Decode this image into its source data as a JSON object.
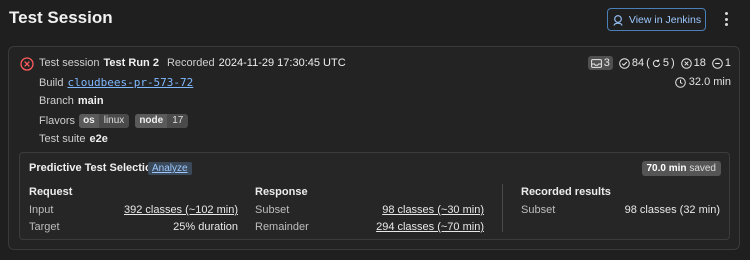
{
  "header": {
    "title": "Test Session",
    "jenkins_button": "View in Jenkins"
  },
  "session": {
    "status": "failed",
    "label_session": "Test session",
    "name": "Test Run 2",
    "label_recorded": "Recorded",
    "recorded": "2024-11-29 17:30:45 UTC",
    "label_build": "Build",
    "build": "cloudbees-pr-573-72",
    "label_branch": "Branch",
    "branch": "main",
    "label_flavors": "Flavors",
    "flavors": [
      {
        "key": "os",
        "value": "linux"
      },
      {
        "key": "node",
        "value": "17"
      }
    ],
    "label_suite": "Test suite",
    "suite": "e2e",
    "stats": {
      "tray": "3",
      "passed": "84",
      "retried": "5",
      "failed": "18",
      "skipped": "1"
    },
    "duration": "32.0 min"
  },
  "pts": {
    "title": "Predictive Test Selection",
    "analyze": "Analyze",
    "saved_value": "70.0 min",
    "saved_label": "saved",
    "request": {
      "heading": "Request",
      "input_label": "Input",
      "input_value": "392 classes (~102 min)",
      "target_label": "Target",
      "target_value": "25% duration"
    },
    "response": {
      "heading": "Response",
      "subset_label": "Subset",
      "subset_value": "98 classes (~30 min)",
      "remainder_label": "Remainder",
      "remainder_value": "294 classes (~70 min)"
    },
    "recorded": {
      "heading": "Recorded results",
      "subset_label": "Subset",
      "subset_value": "98 classes (32 min)"
    }
  },
  "colors": {
    "background": "#1f1f1f",
    "link": "#7fb8ff",
    "fail": "#ff5c5c"
  }
}
